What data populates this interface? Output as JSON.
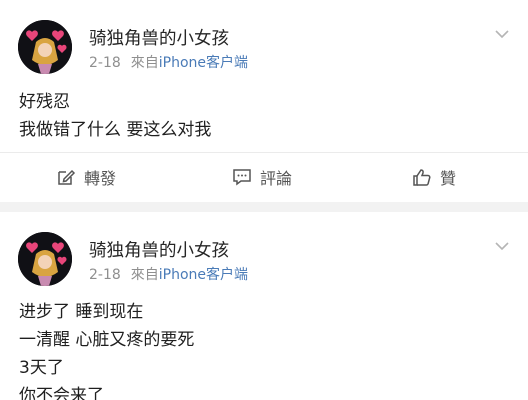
{
  "posts": [
    {
      "username": "骑独角兽的小女孩",
      "date": "2-18",
      "source_prefix": "來自",
      "source": "iPhone客户端",
      "lines": [
        "好残忍",
        "我做错了什么 要这么对我"
      ],
      "actions": {
        "repost_label": "轉發",
        "comment_label": "評論",
        "like_label": "贊"
      }
    },
    {
      "username": "骑独角兽的小女孩",
      "date": "2-18",
      "source_prefix": "來自",
      "source": "iPhone客户端",
      "lines": [
        "进步了 睡到现在",
        "一清醒 心脏又疼的要死",
        "3天了",
        "你不会来了"
      ]
    }
  ],
  "icons": {
    "expand": "chevron-down-icon",
    "repost": "edit-square-icon",
    "comment": "comment-bubble-icon",
    "like": "thumbs-up-icon"
  },
  "colors": {
    "source_link": "#4a7bb7",
    "meta_gray": "#8f8f8f",
    "background": "#f2f2f2"
  }
}
